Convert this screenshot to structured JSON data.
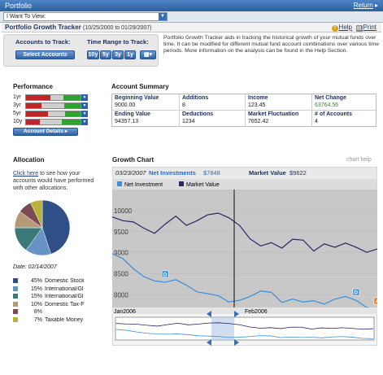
{
  "window": {
    "title": "Portfolio",
    "return_label": "Return",
    "return_arrow": "▸"
  },
  "toolbar": {
    "select_value": "I Want To View:"
  },
  "header": {
    "title": "Portfolio Growth Tracker",
    "date_range": "(10/25/2000 to 01/29/2007)",
    "help_label": "Help",
    "print_label": "Print"
  },
  "controls": {
    "accounts_label": "Accounts to Track:",
    "select_accounts_button": "Select Accounts",
    "time_range_label": "Time Range to Track:",
    "time_buttons": [
      "10y",
      "5y",
      "3y",
      "1y"
    ],
    "calendar_icon": "calendar-icon"
  },
  "description": "Portfolio Growth Tracker aids in tracking the historical growth of your mutual funds over time. It can be modified for different mutual fund account combinations over various time periods. More information on the analysis can be found in the Help Section.",
  "performance": {
    "title": "Performance",
    "rows": [
      {
        "label": "1yr",
        "red_fraction": 0.45,
        "green_fraction": 0.32
      },
      {
        "label": "3yr",
        "red_fraction": 0.28,
        "green_fraction": 0.3
      },
      {
        "label": "5yr",
        "red_fraction": 0.4,
        "green_fraction": 0.28
      },
      {
        "label": "10y",
        "red_fraction": 0.25,
        "green_fraction": 0.35
      }
    ],
    "details_button": "Account Details ▸"
  },
  "account_summary": {
    "title": "Account Summary",
    "beginning_value_label": "Beginning Value",
    "beginning_value": "9000.00",
    "additions_label": "Additions",
    "additions": "8",
    "income_label": "Income",
    "income": "123.45",
    "net_change_label": "Net Change",
    "net_change": "63764.56",
    "ending_value_label": "Ending Value",
    "ending_value": "94357.13",
    "deductions_label": "Deductions",
    "deductions": "1234",
    "market_fluctuation_label": "Market Fluctuation",
    "market_fluctuation": "7652.42",
    "num_accounts_label": "# of Accounts",
    "num_accounts": "4"
  },
  "allocation": {
    "title": "Allocation",
    "click_here": "Click here",
    "click_text": " to see how your accounts would have performed with other allocations.",
    "date": "Date: 02/14/2007",
    "items": [
      {
        "pct": "45%",
        "name": "Domestic Stock",
        "color": "#2f4f87"
      },
      {
        "pct": "15%",
        "name": "International/Gl",
        "color": "#6792c4"
      },
      {
        "pct": "15%",
        "name": "International/Gl",
        "color": "#3b7a78"
      },
      {
        "pct": "10%",
        "name": "Domestic Tax-F",
        "color": "#b59a7a"
      },
      {
        "pct": "8%",
        "name": "",
        "color": "#7a4b52"
      },
      {
        "pct": "7%",
        "name": "Taxable Money",
        "color": "#b8b23a"
      }
    ]
  },
  "growth_chart": {
    "title": "Growth Chart",
    "help_link": "chart help",
    "readout_date": "03/23/2007",
    "readout_net_label": "Net Investments",
    "readout_net_value": "$7848",
    "readout_market_label": "Market Value",
    "readout_market_value": "$9622"
  },
  "chart_data": {
    "type": "line",
    "series": [
      {
        "name": "Net Investment",
        "color": "#3b8ed8",
        "values": [
          8980,
          8860,
          8620,
          8430,
          8330,
          8300,
          8360,
          8230,
          8070,
          8030,
          7980,
          7830,
          7870,
          7960,
          8090,
          8060,
          7820,
          7900,
          7830,
          7860,
          7780,
          7900,
          7960,
          7870,
          7700,
          7660
        ]
      },
      {
        "name": "Market Value",
        "color": "#2b2464",
        "values": [
          9850,
          9760,
          9730,
          9580,
          9460,
          9680,
          9870,
          9650,
          9760,
          9900,
          9940,
          9830,
          9650,
          9330,
          9160,
          9240,
          9110,
          9320,
          9300,
          9040,
          9210,
          9130,
          9230,
          9130,
          9010,
          9090
        ]
      }
    ],
    "ylim": [
      7700,
      10500
    ],
    "yticks": [
      8000,
      8500,
      9000,
      9500,
      10000
    ],
    "xticks": [
      "Jan2006",
      "Feb2006"
    ],
    "legend": "top",
    "markers": [
      "D",
      "D",
      "A"
    ]
  }
}
